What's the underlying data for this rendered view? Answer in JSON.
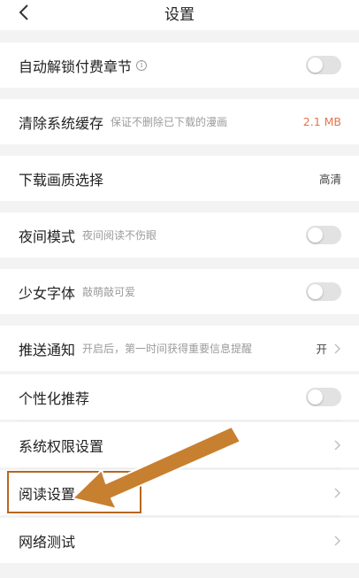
{
  "header": {
    "title": "设置",
    "back_icon": "chevron-left-icon"
  },
  "settings": [
    {
      "label": "自动解锁付费章节",
      "sub": "",
      "control": "toggle",
      "on": false,
      "info_icon": "i"
    },
    {
      "label": "清除系统缓存",
      "sub": "保证不删除已下载的漫画",
      "control": "value",
      "value": "2.1 MB",
      "accent_color": "#e5734d"
    },
    {
      "label": "下载画质选择",
      "sub": "",
      "control": "value",
      "value": "高清"
    },
    {
      "label": "夜间模式",
      "sub": "夜间阅读不伤眼",
      "control": "toggle",
      "on": false
    },
    {
      "label": "少女字体",
      "sub": "敲萌敲可爱",
      "control": "toggle",
      "on": false
    },
    {
      "label": "推送通知",
      "sub": "开启后，第一时间获得重要信息提醒",
      "control": "value_chevron",
      "value": "开"
    },
    {
      "label": "个性化推荐",
      "sub": "",
      "control": "toggle",
      "on": false
    },
    {
      "label": "系统权限设置",
      "sub": "",
      "control": "chevron"
    },
    {
      "label": "阅读设置",
      "sub": "",
      "control": "chevron",
      "highlighted": true
    },
    {
      "label": "网络测试",
      "sub": "",
      "control": "chevron"
    }
  ],
  "annotation": {
    "color": "#b7651f"
  }
}
